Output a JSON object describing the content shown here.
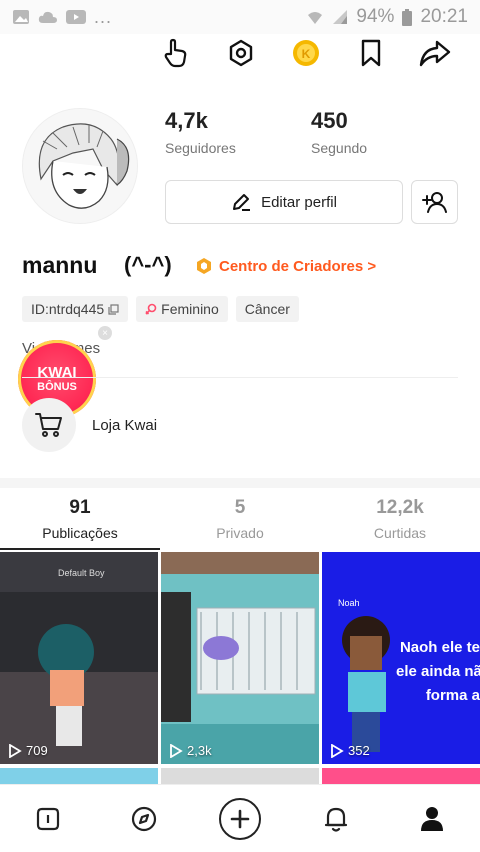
{
  "status": {
    "battery": "94%",
    "time": "20:21",
    "more": "..."
  },
  "profile": {
    "followers_count": "4,7k",
    "followers_label": "Seguidores",
    "following_count": "450",
    "following_label": "Segundo",
    "edit_label": "Editar perfil",
    "name": "mannu",
    "emote": "(^-^)",
    "creator_center": "Centro de Criadores >",
    "tags": [
      {
        "label": "ID:ntrdq445"
      },
      {
        "label": "Feminino"
      },
      {
        "label": "Câncer"
      }
    ],
    "bio": "Vi... Games",
    "bonus_line1": "KWAI",
    "bonus_line2": "BÔNUS",
    "shop_label": "Loja Kwai"
  },
  "tabs": [
    {
      "count": "91",
      "label": "Publicações",
      "active": true
    },
    {
      "count": "5",
      "label": "Privado",
      "active": false
    },
    {
      "count": "12,2k",
      "label": "Curtidas",
      "active": false
    }
  ],
  "videos": [
    {
      "views": "709",
      "caption": "Default Boy"
    },
    {
      "views": "2,3k"
    },
    {
      "views": "352",
      "caption": "Noah",
      "overlay": "Naoh ele te\nele ainda nã\nforma a"
    }
  ],
  "colors": {
    "accent": "#ff5a1f",
    "bonus": "#ff2a55",
    "coin": "#f5b800"
  }
}
